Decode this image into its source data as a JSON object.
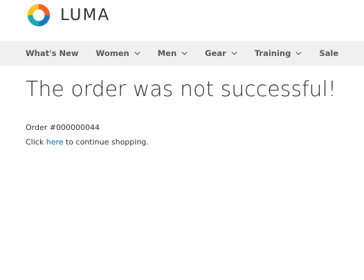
{
  "brand": {
    "name": "LUMA",
    "colors": {
      "orange": "#f26322",
      "yellow": "#f8c41d",
      "teal": "#1aa8b1",
      "blue": "#1979c3"
    }
  },
  "nav": {
    "items": [
      {
        "label": "What's New",
        "has_dropdown": false
      },
      {
        "label": "Women",
        "has_dropdown": true
      },
      {
        "label": "Men",
        "has_dropdown": true
      },
      {
        "label": "Gear",
        "has_dropdown": true
      },
      {
        "label": "Training",
        "has_dropdown": true
      },
      {
        "label": "Sale",
        "has_dropdown": false
      }
    ]
  },
  "page": {
    "title": "The order was not successful!",
    "order_text": "Order #000000044",
    "continue_prefix": "Click ",
    "continue_link": "here",
    "continue_suffix": " to continue shopping."
  },
  "colors": {
    "nav_bg": "#f0f0f0",
    "link": "#006bb4",
    "text": "#333333"
  }
}
